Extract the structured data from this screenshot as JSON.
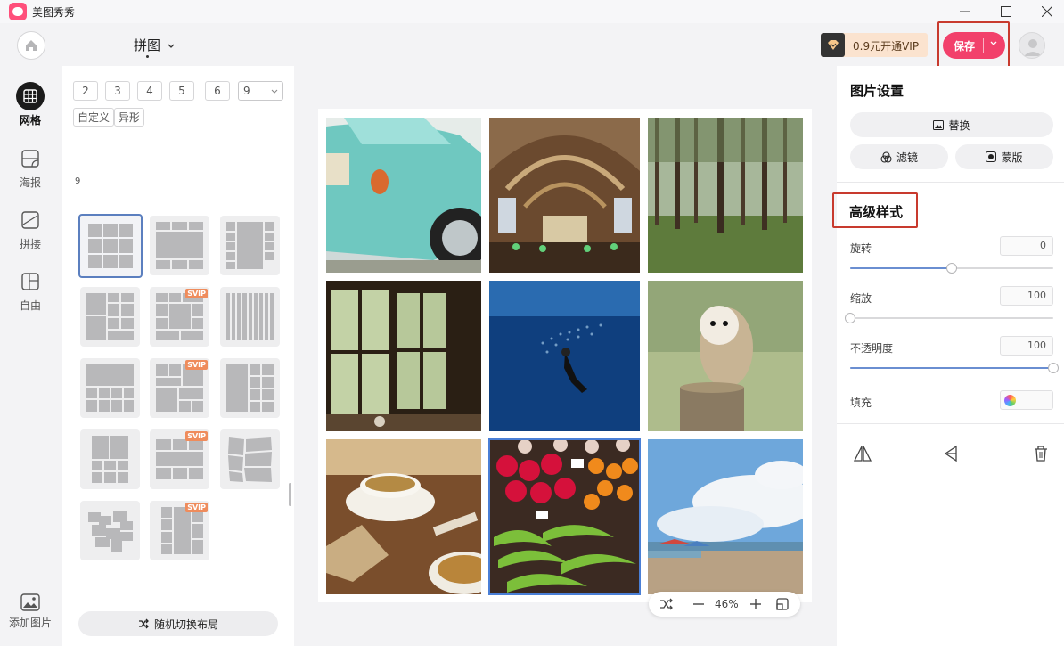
{
  "window": {
    "app_title": "美图秀秀",
    "controls": [
      "minimize-icon",
      "maximize-icon",
      "close-icon"
    ]
  },
  "toolbar": {
    "mode_title": "拼图",
    "vip_label": "0.9元开通VIP",
    "save_label": "保存"
  },
  "left_nav": {
    "items": [
      {
        "label": "网格",
        "icon": "grid-icon",
        "active": true
      },
      {
        "label": "海报",
        "icon": "poster-icon",
        "active": false
      },
      {
        "label": "拼接",
        "icon": "stitch-icon",
        "active": false
      },
      {
        "label": "自由",
        "icon": "free-layout-icon",
        "active": false
      }
    ],
    "add_image_label": "添加图片"
  },
  "layout_panel": {
    "counts": [
      "2",
      "3",
      "4",
      "5",
      "6"
    ],
    "count_selected": "9",
    "tags": [
      "自定义",
      "异形"
    ],
    "section_label": "9",
    "templates": [
      {
        "svip": false,
        "selected": true
      },
      {
        "svip": false,
        "selected": false
      },
      {
        "svip": false,
        "selected": false
      },
      {
        "svip": false,
        "selected": false
      },
      {
        "svip": true,
        "selected": false
      },
      {
        "svip": false,
        "selected": false
      },
      {
        "svip": false,
        "selected": false
      },
      {
        "svip": true,
        "selected": false
      },
      {
        "svip": false,
        "selected": false
      },
      {
        "svip": false,
        "selected": false
      },
      {
        "svip": true,
        "selected": false
      },
      {
        "svip": false,
        "selected": false
      },
      {
        "svip": false,
        "selected": false
      },
      {
        "svip": true,
        "selected": false
      }
    ],
    "svip_badge": "SVIP",
    "shuffle_label": "随机切换布局"
  },
  "canvas": {
    "photos": [
      {
        "subject": "teal vintage car",
        "selected": false
      },
      {
        "subject": "library hall",
        "selected": false
      },
      {
        "subject": "pine forest",
        "selected": false
      },
      {
        "subject": "window with vines",
        "selected": false
      },
      {
        "subject": "diver with fish",
        "selected": false
      },
      {
        "subject": "barn owl",
        "selected": false
      },
      {
        "subject": "soup and bread",
        "selected": false
      },
      {
        "subject": "fruit market",
        "selected": true
      },
      {
        "subject": "beach and sky",
        "selected": false
      }
    ],
    "zoom": "46%"
  },
  "right_panel": {
    "title": "图片设置",
    "replace_label": "替换",
    "filter_label": "滤镜",
    "mask_label": "蒙版",
    "advanced_title": "高级样式",
    "rotate": {
      "label": "旋转",
      "value": "0",
      "position": 0.5
    },
    "scale": {
      "label": "缩放",
      "value": "100",
      "position": 0
    },
    "opacity": {
      "label": "不透明度",
      "value": "100",
      "position": 1
    },
    "fill_label": "填充"
  },
  "colors": {
    "accent": "#f2406b",
    "highlight": "#c83a2e",
    "slider": "#6a8ed1"
  }
}
